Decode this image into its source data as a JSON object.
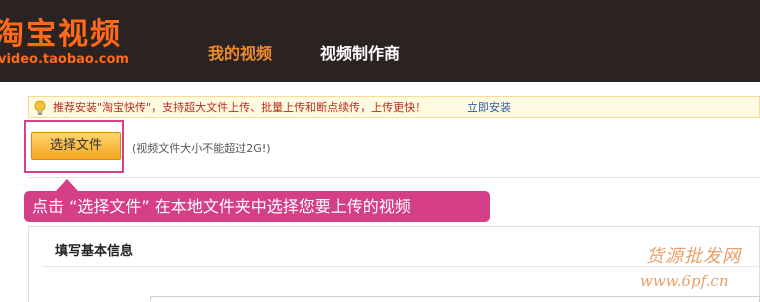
{
  "header": {
    "logo_title": "淘宝视频",
    "logo_url": "video.taobao.com",
    "nav": [
      {
        "label": "我的视频",
        "active": true
      },
      {
        "label": "视频制作商",
        "active": false
      }
    ]
  },
  "notice": {
    "icon": "lightbulb-icon",
    "text": "推荐安装\"淘宝快传\"，支持超大文件上传、批量上传和断点续传，上传更快！",
    "link": "立即安装"
  },
  "upload": {
    "button_label": "选择文件",
    "size_hint": "(视频文件大小不能超过2G!)"
  },
  "callout": {
    "text": "点击 “选择文件” 在本地文件夹中选择您要上传的视频"
  },
  "form": {
    "section_title": "填写基本信息"
  },
  "watermark": {
    "text": "货源批发网",
    "url": "www.6pf.cn"
  },
  "colors": {
    "header_bg": "#2b2321",
    "brand_orange": "#ff6a1a",
    "nav_active": "#f08a2c",
    "callout_pink": "#d53f87",
    "button_orange": "#f4a51e",
    "notice_red": "#c02a1c",
    "link_blue": "#2e5ca8"
  }
}
